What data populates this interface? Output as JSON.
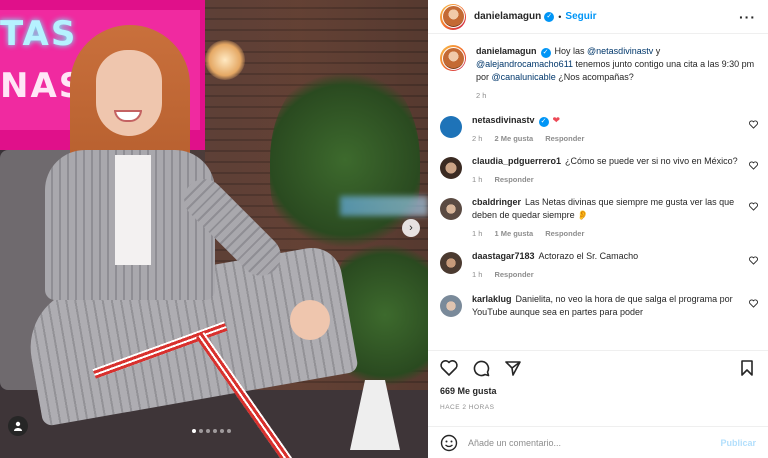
{
  "post": {
    "carousel_dots": 6,
    "active_dot": 0
  },
  "header": {
    "username": "danielamagun",
    "separator": "•",
    "follow_label": "Seguir",
    "more_label": "···"
  },
  "caption": {
    "username": "danielamagun",
    "text_part1": "Hoy las ",
    "mention1": "@netasdivinastv",
    "text_part2": " y ",
    "mention2": "@alejandrocamacho611",
    "text_part3": " tenemos junto contigo una cita a las 9:30 pm por ",
    "mention3": "@canalunicable",
    "text_part4": " ¿Nos acompañas?",
    "time": "2 h"
  },
  "comments": [
    {
      "username": "netasdivinastv",
      "verified": true,
      "text": "",
      "emoji": "❤",
      "time": "2 h",
      "likes": "2 Me gusta",
      "reply": "Responder"
    },
    {
      "username": "claudia_pdguerrero1",
      "verified": false,
      "text": "¿Cómo se puede ver si no vivo en México?",
      "time": "1 h",
      "likes": "",
      "reply": "Responder"
    },
    {
      "username": "cbaldringer",
      "verified": false,
      "text": "Las Netas divinas que siempre me gusta ver las que deben de quedar siempre 👂",
      "time": "1 h",
      "likes": "1 Me gusta",
      "reply": "Responder"
    },
    {
      "username": "daastagar7183",
      "verified": false,
      "text": "Actorazo el Sr. Camacho",
      "time": "1 h",
      "likes": "",
      "reply": "Responder"
    },
    {
      "username": "karlaklug",
      "verified": false,
      "text": "Danielita, no veo la hora de que salga el programa por YouTube aunque sea en partes para poder",
      "time": "",
      "likes": "",
      "reply": ""
    }
  ],
  "actions": {
    "likes_count": "669 Me gusta",
    "posted_ago": "HACE 2 HORAS"
  },
  "add_comment": {
    "placeholder": "Añade un comentario...",
    "publish_label": "Publicar"
  },
  "image_sign": {
    "line1": "TAS",
    "line2": "NAS"
  },
  "colors": {
    "accent": "#0095f6",
    "heart_red": "#ed4956",
    "publish_disabled": "#b2dffc"
  }
}
